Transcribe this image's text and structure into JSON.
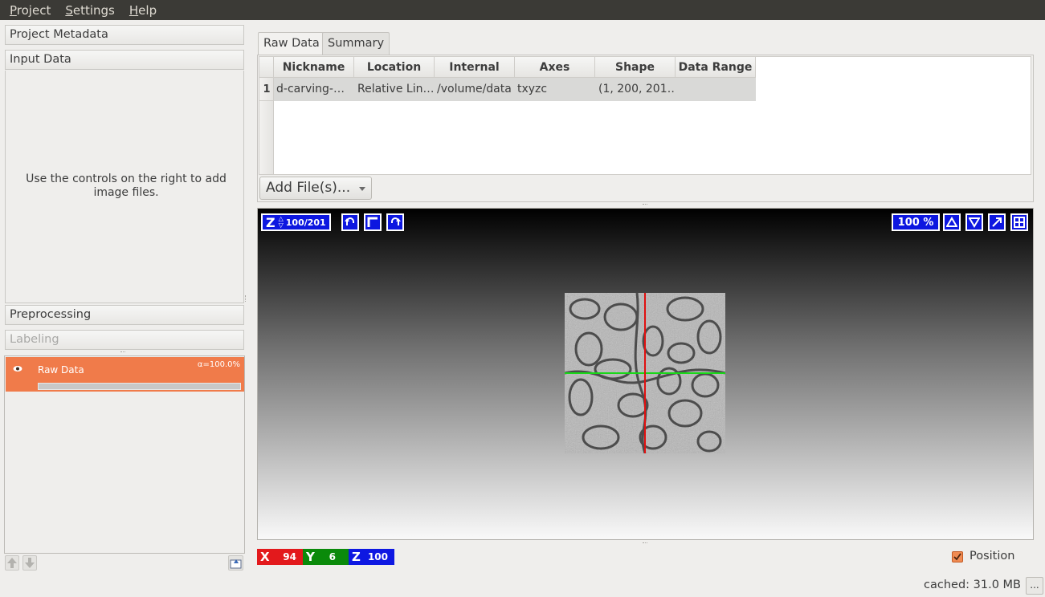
{
  "menubar": {
    "items": [
      {
        "label": "Project"
      },
      {
        "label": "Settings"
      },
      {
        "label": "Help"
      }
    ]
  },
  "applets": {
    "project_metadata": "Project Metadata",
    "input_data": "Input Data",
    "input_hint": "Use the controls on the right to add image files.",
    "preprocessing": "Preprocessing",
    "labeling": "Labeling"
  },
  "layers": {
    "items": [
      {
        "name": "Raw Data",
        "opacity": "α=100.0%",
        "visible": true
      }
    ]
  },
  "data_tabs": {
    "tabs": [
      {
        "label": "Raw Data",
        "active": true
      },
      {
        "label": "Summary",
        "active": false
      }
    ]
  },
  "dataset_table": {
    "columns": [
      "Nickname",
      "Location",
      "Internal Path",
      "Axes",
      "Shape",
      "Data Range"
    ],
    "rows": [
      {
        "index": "1",
        "cells": [
          "d-carving-…",
          "Relative Lin…",
          "/volume/data",
          "txyzc",
          "(1, 200, 201…",
          ""
        ]
      }
    ]
  },
  "add_files_button": "Add File(s)...",
  "viewer": {
    "slice_axis": "Z",
    "slice_position": "100/201",
    "zoom": "100 %",
    "crosshair": {
      "horizontal_color": "#18d818",
      "vertical_color": "#e01010"
    }
  },
  "position": {
    "x": {
      "axis": "X",
      "value": "94",
      "color": "#e3191c"
    },
    "y": {
      "axis": "Y",
      "value": "6",
      "color": "#0a8a0a"
    },
    "z": {
      "axis": "Z",
      "value": "100",
      "color": "#0e18e2"
    },
    "checkbox_label": "Position",
    "checked": true
  },
  "status": {
    "cache": "cached: 31.0 MB",
    "more": "..."
  },
  "colors": {
    "accent": "#f07b4a",
    "viewer_button": "#0d17e0",
    "menubar": "#3b3a36"
  }
}
